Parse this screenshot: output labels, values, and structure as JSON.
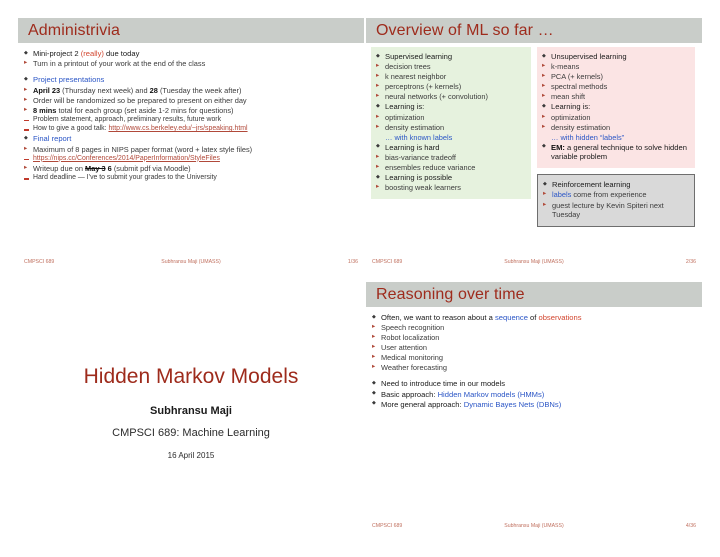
{
  "deck": {
    "footer_left": "CMPSCI 689",
    "footer_center": "Subhransu Maji (UMASS)"
  },
  "slide_admin": {
    "title": "Administrivia",
    "page": "1/36",
    "items": [
      {
        "level": 1,
        "parts": [
          {
            "t": "Mini-project 2 ",
            "style": "normal"
          },
          {
            "t": "(really)",
            "style": "red"
          },
          {
            "t": " due today",
            "style": "normal"
          }
        ]
      },
      {
        "level": 2,
        "parts": [
          {
            "t": "Turn in a printout of your work at the end of the class",
            "style": "normal"
          }
        ]
      },
      {
        "level": 1,
        "spacer": true,
        "parts": [
          {
            "t": "Project presentations",
            "style": "blue"
          }
        ]
      },
      {
        "level": 2,
        "parts": [
          {
            "t": "April 23",
            "style": "bold"
          },
          {
            "t": " (Thursday next week) and ",
            "style": "normal"
          },
          {
            "t": "28",
            "style": "bold"
          },
          {
            "t": " (Tuesday the week after)",
            "style": "normal"
          }
        ]
      },
      {
        "level": 2,
        "parts": [
          {
            "t": "Order will be randomized so be prepared to present on either day",
            "style": "normal"
          }
        ]
      },
      {
        "level": 2,
        "parts": [
          {
            "t": "8 mins",
            "style": "bold"
          },
          {
            "t": " total for each group (set aside 1-2 mins for questions)",
            "style": "normal"
          }
        ]
      },
      {
        "level": 3,
        "parts": [
          {
            "t": "Problem statement, approach, preliminary results, future work",
            "style": "normal"
          }
        ]
      },
      {
        "level": 3,
        "parts": [
          {
            "t": "How to give a good talk: ",
            "style": "normal"
          },
          {
            "t": "http://www.cs.berkeley.edu/~jrs/speaking.html",
            "style": "link"
          }
        ]
      },
      {
        "level": 1,
        "parts": [
          {
            "t": "Final report",
            "style": "blue"
          }
        ]
      },
      {
        "level": 2,
        "parts": [
          {
            "t": "Maximum of 8 pages in NIPS paper format (word + latex style files)",
            "style": "normal"
          }
        ]
      },
      {
        "level": 3,
        "parts": [
          {
            "t": "https://nips.cc/Conferences/2014/PaperInformation/StyleFiles",
            "style": "link"
          }
        ]
      },
      {
        "level": 2,
        "parts": [
          {
            "t": "Writeup due on ",
            "style": "normal"
          },
          {
            "t": "May 3",
            "style": "bold-strike"
          },
          {
            "t": " 6",
            "style": "bold"
          },
          {
            "t": " (submit pdf via Moodle)",
            "style": "normal"
          }
        ]
      },
      {
        "level": 3,
        "parts": [
          {
            "t": "Hard deadline — I’ve to submit your grades to the University",
            "style": "normal"
          }
        ]
      }
    ]
  },
  "slide_overview": {
    "title": "Overview of ML so far …",
    "page": "2/36",
    "box_supervised": {
      "name": "supervised-box",
      "items": [
        {
          "level": 1,
          "parts": [
            {
              "t": "Supervised learning",
              "style": "normal"
            }
          ]
        },
        {
          "level": 2,
          "parts": [
            {
              "t": "decision trees",
              "style": "normal"
            }
          ]
        },
        {
          "level": 2,
          "parts": [
            {
              "t": "k nearest neighbor",
              "style": "normal"
            }
          ]
        },
        {
          "level": 2,
          "parts": [
            {
              "t": "perceptrons (+ kernels)",
              "style": "normal"
            }
          ]
        },
        {
          "level": 2,
          "parts": [
            {
              "t": "neural networks (+ convolution)",
              "style": "normal"
            }
          ]
        },
        {
          "level": 1,
          "parts": [
            {
              "t": "Learning is:",
              "style": "normal"
            }
          ]
        },
        {
          "level": 2,
          "parts": [
            {
              "t": "optimization",
              "style": "normal"
            }
          ]
        },
        {
          "level": 2,
          "parts": [
            {
              "t": "density estimation",
              "style": "normal"
            }
          ]
        },
        {
          "level": 0,
          "parts": [
            {
              "t": "… with known labels",
              "style": "blue"
            }
          ]
        },
        {
          "level": 1,
          "parts": [
            {
              "t": "Learning is hard",
              "style": "normal"
            }
          ]
        },
        {
          "level": 2,
          "parts": [
            {
              "t": "bias-variance tradeoff",
              "style": "normal"
            }
          ]
        },
        {
          "level": 2,
          "parts": [
            {
              "t": "ensembles reduce variance",
              "style": "normal"
            }
          ]
        },
        {
          "level": 1,
          "parts": [
            {
              "t": "Learning is possible",
              "style": "normal"
            }
          ]
        },
        {
          "level": 2,
          "parts": [
            {
              "t": "boosting weak learners",
              "style": "normal"
            }
          ]
        }
      ]
    },
    "box_unsupervised": {
      "name": "unsupervised-box",
      "items": [
        {
          "level": 1,
          "parts": [
            {
              "t": "Unsupervised learning",
              "style": "normal"
            }
          ]
        },
        {
          "level": 2,
          "parts": [
            {
              "t": "k-means",
              "style": "normal"
            }
          ]
        },
        {
          "level": 2,
          "parts": [
            {
              "t": "PCA (+ kernels)",
              "style": "normal"
            }
          ]
        },
        {
          "level": 2,
          "parts": [
            {
              "t": "spectral methods",
              "style": "normal"
            }
          ]
        },
        {
          "level": 2,
          "parts": [
            {
              "t": "mean shift",
              "style": "normal"
            }
          ]
        },
        {
          "level": 1,
          "parts": [
            {
              "t": "Learning is:",
              "style": "normal"
            }
          ]
        },
        {
          "level": 2,
          "parts": [
            {
              "t": "optimization",
              "style": "normal"
            }
          ]
        },
        {
          "level": 2,
          "parts": [
            {
              "t": "density estimation",
              "style": "normal"
            }
          ]
        },
        {
          "level": 0,
          "parts": [
            {
              "t": "… with hidden “labels”",
              "style": "blue"
            }
          ]
        },
        {
          "level": 1,
          "parts": [
            {
              "t": "EM:",
              "style": "bold"
            },
            {
              "t": " a general technique to solve hidden variable problem",
              "style": "normal"
            }
          ]
        }
      ]
    },
    "box_reinforcement": {
      "name": "reinforcement-box",
      "items": [
        {
          "level": 1,
          "parts": [
            {
              "t": "Reinforcement learning",
              "style": "normal"
            }
          ]
        },
        {
          "level": 2,
          "parts": [
            {
              "t": "labels",
              "style": "blue"
            },
            {
              "t": " come from experience",
              "style": "normal"
            }
          ]
        },
        {
          "level": 2,
          "parts": [
            {
              "t": "guest lecture by Kevin Spiteri next Tuesday",
              "style": "normal"
            }
          ]
        }
      ]
    }
  },
  "slide_title": {
    "heading": "Hidden Markov Models",
    "author": "Subhransu Maji",
    "course": "CMPSCI 689: Machine Learning",
    "date": "16 April 2015"
  },
  "slide_reasoning": {
    "title": "Reasoning over time",
    "page": "4/36",
    "items": [
      {
        "level": 1,
        "parts": [
          {
            "t": "Often, we want to reason about a ",
            "style": "normal"
          },
          {
            "t": "sequence",
            "style": "blue"
          },
          {
            "t": " of ",
            "style": "normal"
          },
          {
            "t": "observations",
            "style": "red"
          }
        ]
      },
      {
        "level": 2,
        "parts": [
          {
            "t": "Speech recognition",
            "style": "normal"
          }
        ]
      },
      {
        "level": 2,
        "parts": [
          {
            "t": "Robot localization",
            "style": "normal"
          }
        ]
      },
      {
        "level": 2,
        "parts": [
          {
            "t": "User attention",
            "style": "normal"
          }
        ]
      },
      {
        "level": 2,
        "parts": [
          {
            "t": "Medical monitoring",
            "style": "normal"
          }
        ]
      },
      {
        "level": 2,
        "parts": [
          {
            "t": "Weather forecasting",
            "style": "normal"
          }
        ]
      },
      {
        "level": 1,
        "spacer": true,
        "parts": [
          {
            "t": "Need to introduce time in our models",
            "style": "normal"
          }
        ]
      },
      {
        "level": 1,
        "parts": [
          {
            "t": "Basic approach: ",
            "style": "normal"
          },
          {
            "t": "Hidden Markov models (HMMs)",
            "style": "blue"
          }
        ]
      },
      {
        "level": 1,
        "parts": [
          {
            "t": "More general approach: ",
            "style": "normal"
          },
          {
            "t": "Dynamic Bayes Nets (DBNs)",
            "style": "blue"
          }
        ]
      }
    ]
  },
  "colors": {
    "banner_bg": "#c9cdc9",
    "title_red": "#9e2b1c",
    "accent_red": "#d2462f",
    "accent_blue": "#2b56c6",
    "box_green": "#e6f2de",
    "box_pink": "#fbe4e4",
    "box_gray": "#d9d9d9",
    "footer": "#c0705f"
  }
}
